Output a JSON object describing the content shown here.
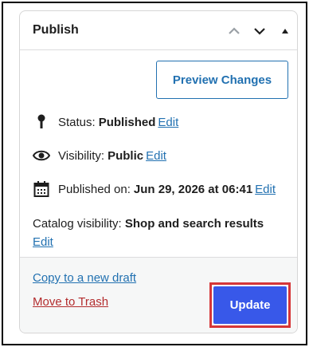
{
  "panel": {
    "title": "Publish"
  },
  "header_controls": {
    "move_up_icon": "chevron-up-icon",
    "move_down_icon": "chevron-down-icon",
    "toggle_icon": "triangle-up-icon"
  },
  "actions": {
    "preview_label": "Preview Changes"
  },
  "status": {
    "icon": "pin-icon",
    "label": "Status:",
    "value": "Published",
    "edit": "Edit"
  },
  "visibility": {
    "icon": "eye-icon",
    "label": "Visibility:",
    "value": "Public",
    "edit": "Edit"
  },
  "published": {
    "icon": "calendar-icon",
    "label": "Published on:",
    "value": "Jun 29, 2026 at 06:41",
    "edit": "Edit"
  },
  "catalog": {
    "label": "Catalog visibility:",
    "value": "Shop and search results",
    "edit": "Edit"
  },
  "footer": {
    "copy_label": "Copy to a new draft",
    "trash_label": "Move to Trash",
    "update_label": "Update"
  },
  "colors": {
    "link": "#2271b1",
    "trash": "#b32d2e",
    "primary_button": "#3858e9",
    "highlight": "#d63638"
  }
}
